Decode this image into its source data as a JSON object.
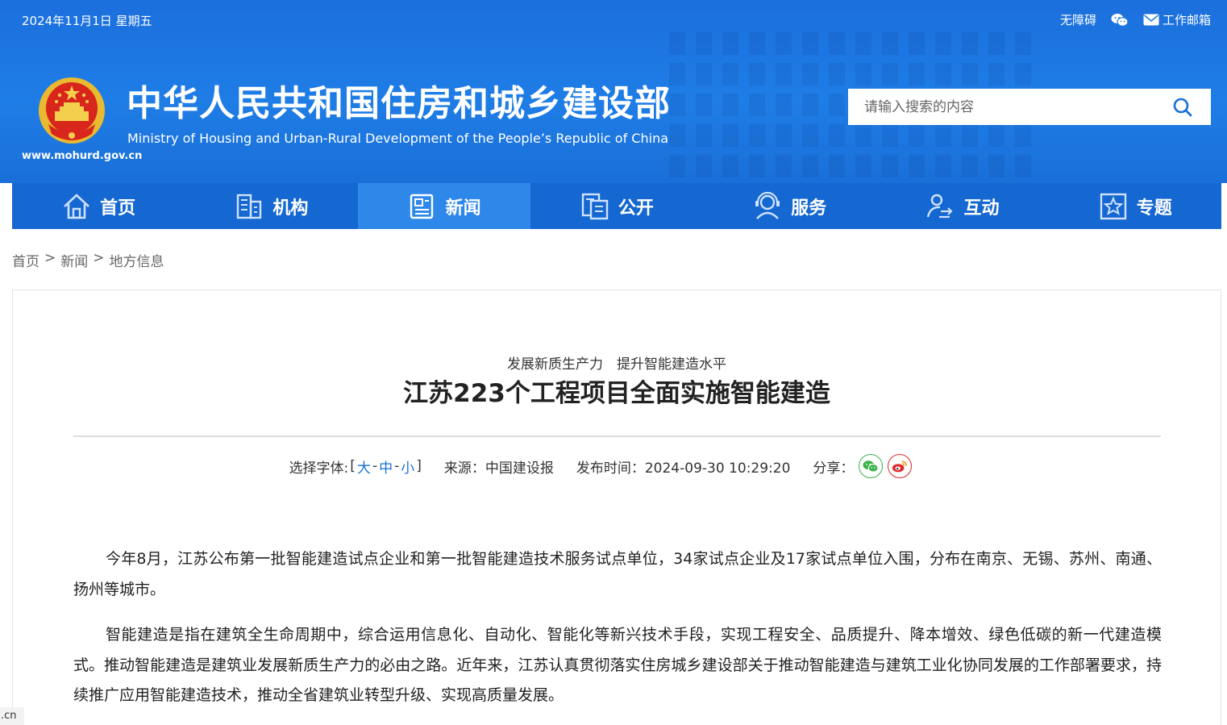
{
  "header": {
    "date": "2024年11月1日 星期五",
    "links": [
      {
        "label": "无障碍",
        "icon": ""
      },
      {
        "label": "",
        "icon": "wechat-icon"
      },
      {
        "label": "工作邮箱",
        "icon": "mail-icon"
      }
    ],
    "title": "中华人民共和国住房和城乡建设部",
    "subtitle": "Ministry of Housing and Urban-Rural Development of the People’s Republic of China",
    "url": "www.mohurd.gov.cn",
    "search_placeholder": "请输入搜索的内容"
  },
  "nav": {
    "items": [
      {
        "label": "首页",
        "icon": "home-icon"
      },
      {
        "label": "机构",
        "icon": "building-icon"
      },
      {
        "label": "新闻",
        "icon": "newspaper-icon",
        "active": true
      },
      {
        "label": "公开",
        "icon": "document-icon"
      },
      {
        "label": "服务",
        "icon": "service-icon"
      },
      {
        "label": "互动",
        "icon": "interact-icon"
      },
      {
        "label": "专题",
        "icon": "star-icon"
      }
    ]
  },
  "breadcrumb": [
    "首页",
    "新闻",
    "地方信息"
  ],
  "breadcrumb_sep": ">",
  "article": {
    "pre_title": "发展新质生产力　提升智能建造水平",
    "title": "江苏223个工程项目全面实施智能建造",
    "font_label": "选择字体:",
    "font_open": "[",
    "font_large": "大",
    "font_medium": "中",
    "font_small": "小",
    "font_close": "]",
    "font_sep": "-",
    "source": "来源：中国建设报",
    "publish_time": "发布时间：2024-09-30 10:29:20",
    "share_label": "分享：",
    "paragraphs": [
      "今年8月，江苏公布第一批智能建造试点企业和第一批智能建造技术服务试点单位，34家试点企业及17家试点单位入围，分布在南京、无锡、苏州、南通、扬州等城市。",
      "智能建造是指在建筑全生命周期中，综合运用信息化、自动化、智能化等新兴技术手段，实现工程安全、品质提升、降本增效、绿色低碳的新一代建造模式。推动智能建造是建筑业发展新质生产力的必由之路。近年来，江苏认真贯彻落实住房城乡建设部关于推动智能建造与建筑工业化协同发展的工作部署要求，持续推广应用智能建造技术，推动全省建筑业转型升级、实现高质量发展。"
    ]
  },
  "corner_tag": ".cn",
  "colors": {
    "header_blue": "#1f7de6",
    "nav_blue": "#1567d1",
    "nav_active": "#2e88ea",
    "link_blue": "#1a6fd8",
    "wechat_green": "#3bb14a",
    "weibo_red": "#e0262a"
  }
}
